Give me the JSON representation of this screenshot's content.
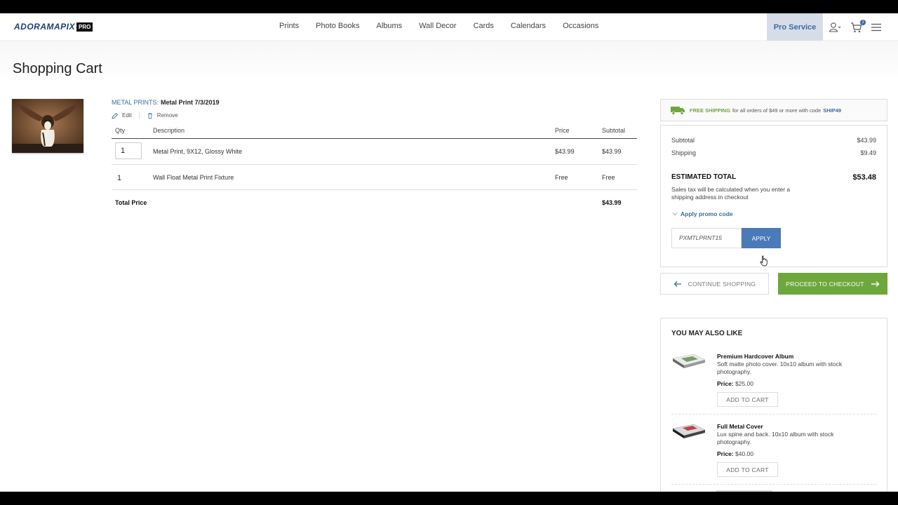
{
  "header": {
    "logo_main": "ADORAMAPIX",
    "logo_pro": "PRO",
    "nav": [
      "Prints",
      "Photo Books",
      "Albums",
      "Wall Decor",
      "Cards",
      "Calendars",
      "Occasions"
    ],
    "pro_service": "Pro Service",
    "cart_count": "1"
  },
  "page_title": "Shopping Cart",
  "product": {
    "category": "METAL PRINTS:",
    "name": "Metal Print 7/3/2019",
    "edit": "Edit",
    "remove": "Remove"
  },
  "table": {
    "headers": {
      "qty": "Qty",
      "description": "Description",
      "price": "Price",
      "subtotal": "Subtotal"
    },
    "rows": [
      {
        "qty": "1",
        "description": "Metal Print, 9X12, Glossy White",
        "price": "$43.99",
        "subtotal": "$43.99"
      },
      {
        "qty": "1",
        "description": "Wall Float Metal Print Fixture",
        "price": "Free",
        "subtotal": "Free"
      }
    ],
    "total_label": "Total Price",
    "total_value": "$43.99"
  },
  "shipping_banner": {
    "free": "FREE SHIPPING",
    "text": "for all orders of $49 or more with code",
    "code": "SHIP49"
  },
  "summary": {
    "subtotal_label": "Subtotal",
    "subtotal_value": "$43.99",
    "shipping_label": "Shipping",
    "shipping_value": "$9.49",
    "estimated_label": "ESTIMATED TOTAL",
    "estimated_value": "$53.48",
    "tax_note": "Sales tax will be calculated when you enter a shipping address in checkout",
    "promo_link": "Apply promo code",
    "promo_value": "PXMTLPRNT15",
    "apply_label": "APPLY"
  },
  "buttons": {
    "continue": "CONTINUE SHOPPING",
    "checkout": "PROCEED TO CHECKOUT"
  },
  "also_like": {
    "title": "YOU MAY ALSO LIKE",
    "items": [
      {
        "name": "Premium Hardcover Album",
        "desc": "Soft matte photo cover. 10x10 album with stock photography.",
        "price_label": "Price:",
        "price": "$25.00",
        "button": "ADD TO CART"
      },
      {
        "name": "Full Metal Cover",
        "desc": "Lux spine and back. 10x10 album with stock photography.",
        "price_label": "Price:",
        "price": "$40.00",
        "button": "ADD TO CART"
      }
    ]
  },
  "colors": {
    "brand_blue": "#3c6aa8",
    "accent_green": "#6ea83c",
    "pro_service_bg": "#d6dde8"
  }
}
